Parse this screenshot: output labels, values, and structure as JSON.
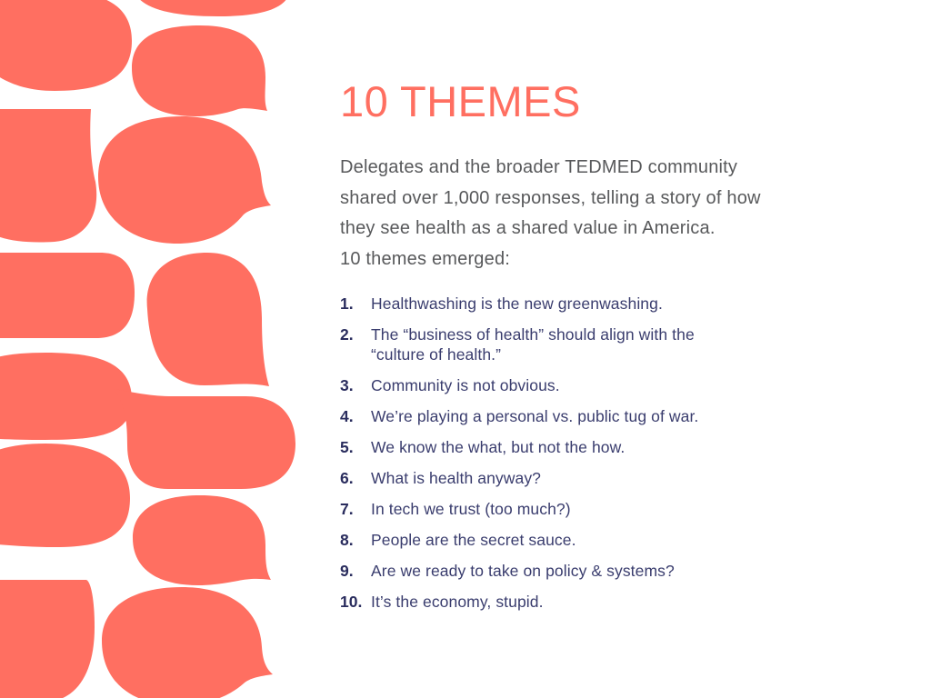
{
  "slide": {
    "title": "10 THEMES",
    "intro_lines": [
      "Delegates and the broader TEDMED community",
      "shared over 1,000 responses, telling a story of how",
      "they see health as a shared value in America.",
      "10 themes emerged:"
    ],
    "themes": [
      {
        "num": "1.",
        "lines": [
          "Healthwashing is the new greenwashing."
        ]
      },
      {
        "num": "2.",
        "lines": [
          "The “business of health” should align with the",
          "“culture of health.”"
        ]
      },
      {
        "num": "3.",
        "lines": [
          "Community is not obvious."
        ]
      },
      {
        "num": "4.",
        "lines": [
          "We’re playing a personal vs. public tug of war."
        ]
      },
      {
        "num": "5.",
        "lines": [
          "We know the what, but not the how."
        ]
      },
      {
        "num": "6.",
        "lines": [
          "What is health anyway?"
        ]
      },
      {
        "num": "7.",
        "lines": [
          "In tech we trust (too much?)"
        ]
      },
      {
        "num": "8.",
        "lines": [
          "People are the secret sauce."
        ]
      },
      {
        "num": "9.",
        "lines": [
          "Are we ready to take on policy & systems?"
        ]
      },
      {
        "num": "10.",
        "lines": [
          "It’s the economy, stupid."
        ]
      }
    ]
  },
  "colors": {
    "accent": "#ff6f61",
    "intro_text": "#58595b",
    "list_text": "#3a3d6e",
    "list_number": "#2a2d5e"
  },
  "decor": {
    "icon": "speech-bubble-pattern"
  }
}
